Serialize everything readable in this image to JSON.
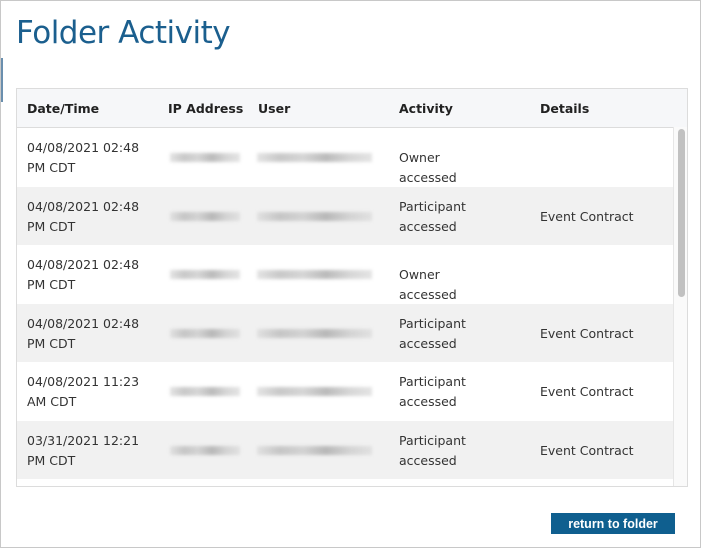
{
  "title": "Folder Activity",
  "columns": [
    "Date/Time",
    "IP Address",
    "User",
    "Activity",
    "Details"
  ],
  "rows": [
    {
      "date": "04/08/2021 02:48",
      "tz": "PM CDT",
      "activity": "Owner accessed",
      "details": ""
    },
    {
      "date": "04/08/2021 02:48",
      "tz": "PM CDT",
      "activity": "Participant accessed",
      "details": "Event Contract"
    },
    {
      "date": "04/08/2021 02:48",
      "tz": "PM CDT",
      "activity": "Owner accessed",
      "details": ""
    },
    {
      "date": "04/08/2021 02:48",
      "tz": "PM CDT",
      "activity": "Participant accessed",
      "details": "Event Contract"
    },
    {
      "date": "04/08/2021 11:23",
      "tz": "AM CDT",
      "activity": "Participant accessed",
      "details": "Event Contract"
    },
    {
      "date": "03/31/2021 12:21",
      "tz": "PM CDT",
      "activity": "Participant accessed",
      "details": "Event Contract"
    }
  ],
  "button": "return to folder",
  "colors": {
    "accent": "#0f5f8f",
    "title": "#1b5f8e"
  }
}
